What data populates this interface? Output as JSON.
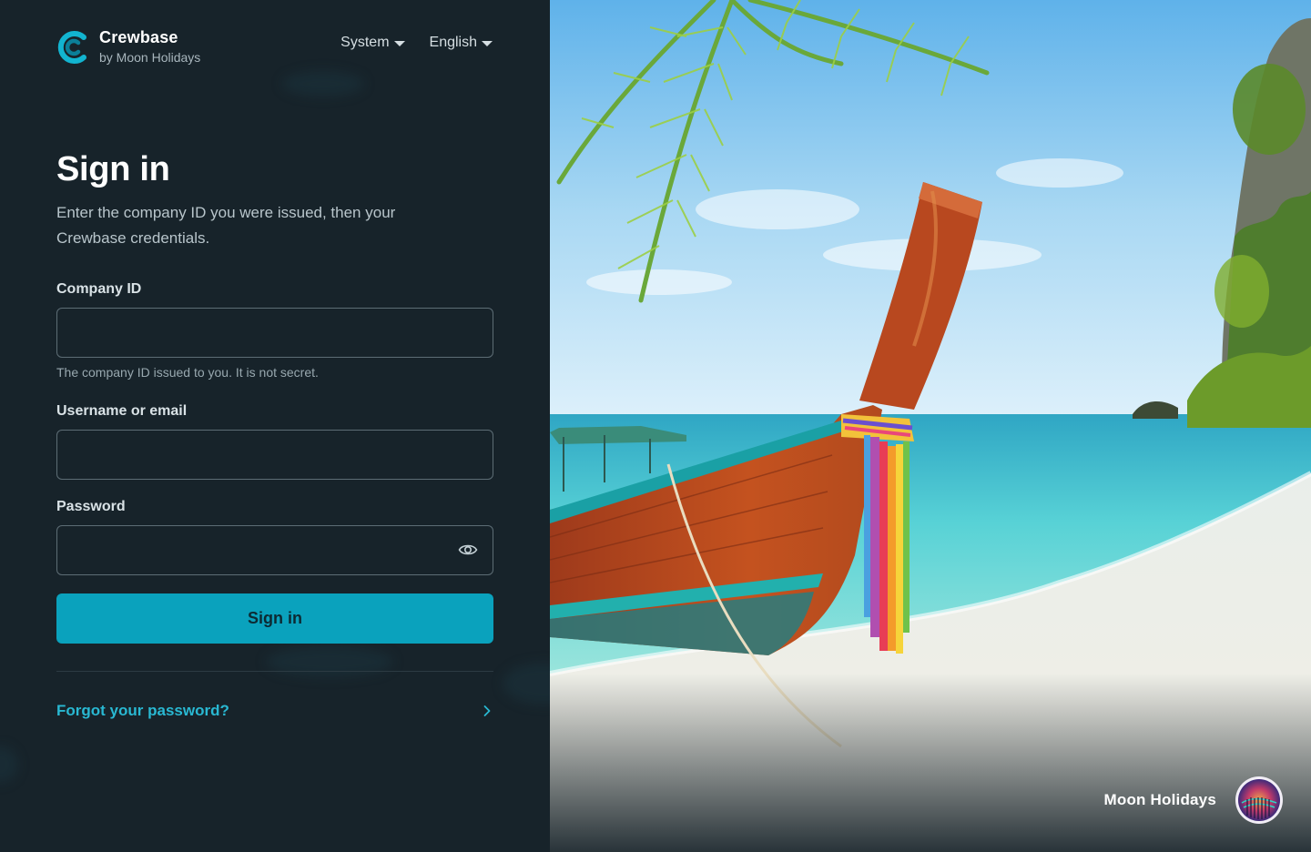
{
  "brand": {
    "name": "Crewbase",
    "sub": "by Moon Holidays"
  },
  "nav": {
    "theme": "System",
    "language": "English"
  },
  "form": {
    "title": "Sign in",
    "subtitle": "Enter the company ID you were issued, then your Crewbase credentials.",
    "company_label": "Company ID",
    "company_value": "",
    "company_hint": "The company ID issued to you. It is not secret.",
    "username_label": "Username or email",
    "username_value": "",
    "password_label": "Password",
    "password_value": "",
    "submit_label": "Sign in",
    "forgot_label": "Forgot your password?"
  },
  "hero": {
    "brand_name": "Moon Holidays"
  },
  "colors": {
    "accent": "#0aa2bd",
    "link": "#29b8d2",
    "panel": "#17232a"
  }
}
